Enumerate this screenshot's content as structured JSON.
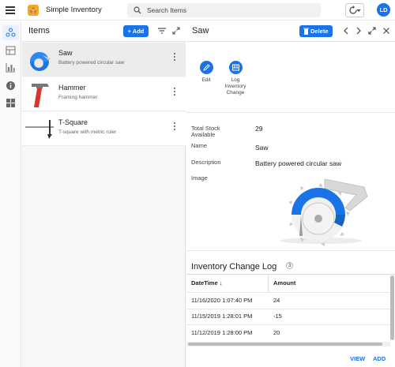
{
  "app": {
    "title": "Simple Inventory",
    "avatar_initials": "LD"
  },
  "search": {
    "placeholder": "Search Items"
  },
  "list": {
    "title": "Items",
    "add_label": "Add",
    "items": [
      {
        "name": "Saw",
        "description": "Battery powered circular saw"
      },
      {
        "name": "Hammer",
        "description": "Framing hammer"
      },
      {
        "name": "T-Square",
        "description": "T-square with metric ruler"
      }
    ]
  },
  "detail": {
    "title": "Saw",
    "delete_label": "Delete",
    "actions": {
      "edit_label": "Edit",
      "log_label_1": "Log",
      "log_label_2": "Inventory",
      "log_label_3": "Change"
    },
    "fields": {
      "stock_label_1": "Total Stock",
      "stock_label_2": "Available",
      "stock_value": "29",
      "name_label": "Name",
      "name_value": "Saw",
      "desc_label": "Description",
      "desc_value": "Battery powered circular saw",
      "image_label": "Image"
    },
    "log": {
      "title": "Inventory Change Log",
      "count": "3",
      "columns": {
        "datetime": "DateTime",
        "amount": "Amount"
      },
      "rows": [
        {
          "datetime": "11/16/2020 1:07:40 PM",
          "amount": "24"
        },
        {
          "datetime": "11/15/2019 1:28:01 PM",
          "amount": "-15"
        },
        {
          "datetime": "11/12/2019 1:28:00 PM",
          "amount": "20"
        }
      ]
    },
    "footer": {
      "view_label": "VIEW",
      "add_label": "ADD"
    }
  },
  "colors": {
    "accent": "#1a73e8"
  }
}
